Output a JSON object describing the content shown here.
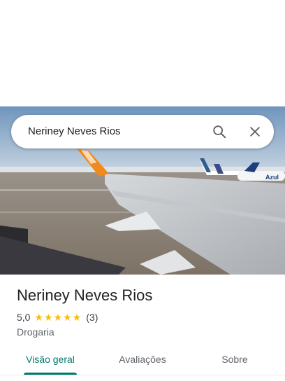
{
  "search": {
    "query": "Neriney Neves Rios"
  },
  "place": {
    "name": "Neriney Neves Rios",
    "rating": "5,0",
    "review_count": "(3)",
    "stars": 5,
    "category": "Drogaria"
  },
  "photo": {
    "tail_text": "Azul"
  },
  "tabs": [
    {
      "label": "Visão geral",
      "active": true
    },
    {
      "label": "Avaliações",
      "active": false
    },
    {
      "label": "Sobre",
      "active": false
    }
  ],
  "colors": {
    "accent": "#00796b",
    "star": "#fbbc04"
  },
  "icons": {
    "search": "search-icon",
    "close": "close-icon",
    "star": "star-icon"
  }
}
